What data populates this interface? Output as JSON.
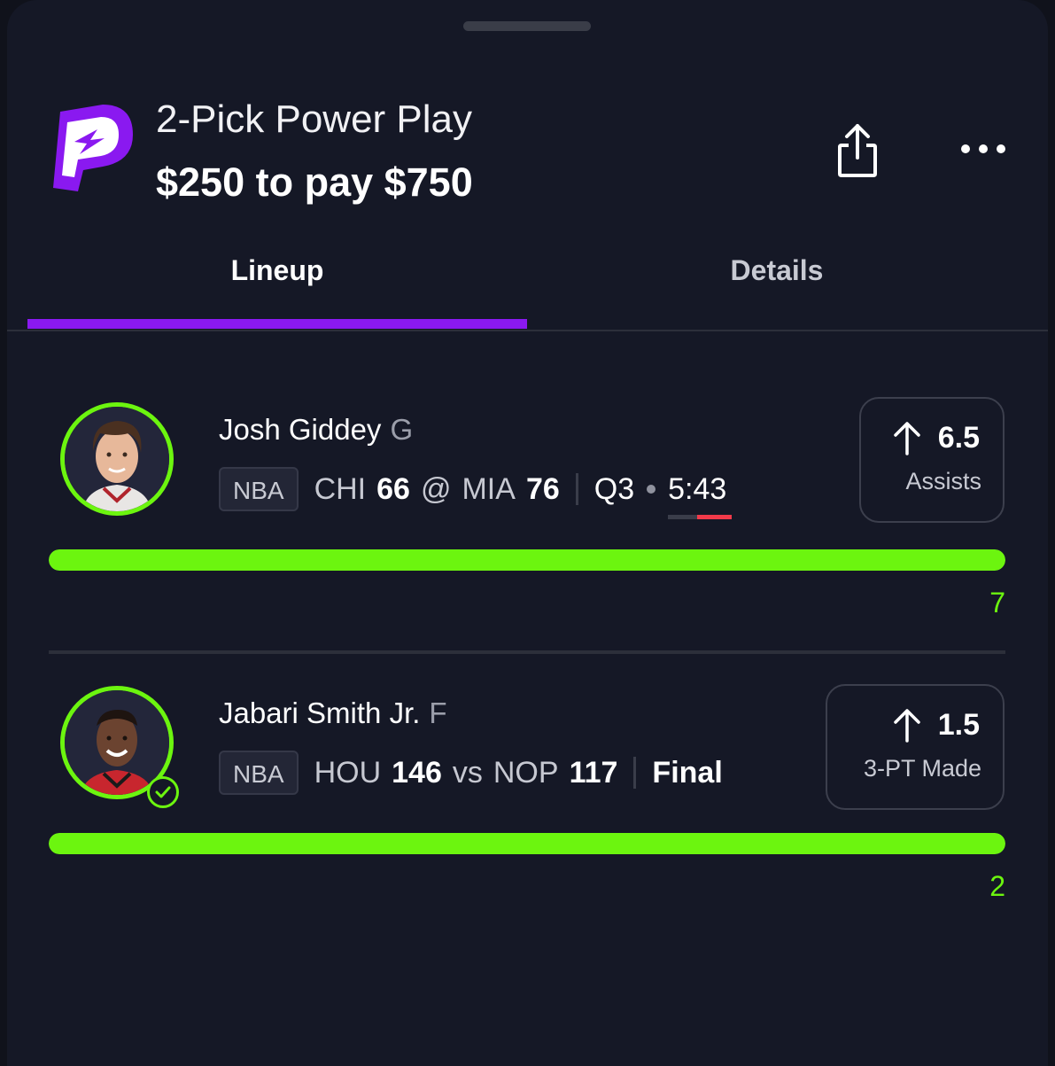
{
  "entry": {
    "title": "2-Pick Power Play",
    "subtitle": "$250 to pay $750"
  },
  "header": {
    "brand_icon": "prizepicks-logo",
    "share_icon": "share-icon",
    "more_icon": "more-horizontal-icon"
  },
  "tabs": [
    {
      "label": "Lineup",
      "active": true
    },
    {
      "label": "Details",
      "active": false
    }
  ],
  "picks": [
    {
      "player": "Josh Giddey",
      "position": "G",
      "league": "NBA",
      "away_team": "CHI",
      "away_score": "66",
      "matchup_sep": "@",
      "home_team": "MIA",
      "home_score": "76",
      "quarter": "Q3",
      "clock": "5:43",
      "clock_progress": 0.55,
      "direction": "up-arrow-icon",
      "line": "6.5",
      "stat": "Assists",
      "actual": "7",
      "progress": 1.0,
      "hit": false
    },
    {
      "player": "Jabari Smith Jr.",
      "position": "F",
      "league": "NBA",
      "away_team": "HOU",
      "away_score": "146",
      "matchup_sep": "vs",
      "home_team": "NOP",
      "home_score": "117",
      "status": "Final",
      "direction": "up-arrow-icon",
      "line": "1.5",
      "stat": "3-PT Made",
      "actual": "2",
      "progress": 1.0,
      "hit": true
    }
  ],
  "colors": {
    "accent_purple": "#8a19f0",
    "progress_green": "#6cf50f",
    "clock_red": "#f23a4a",
    "background": "#151826"
  }
}
